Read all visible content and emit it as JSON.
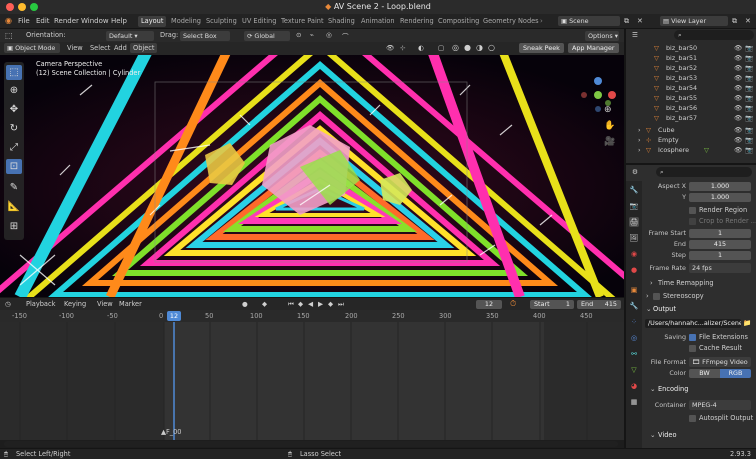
{
  "window": {
    "title": "AV Scene 2 - Loop.blend"
  },
  "menu": {
    "items": [
      "File",
      "Edit",
      "Render",
      "Window",
      "Help"
    ],
    "workspaces": [
      "Layout",
      "Modeling",
      "Sculpting",
      "UV Editing",
      "Texture Paint",
      "Shading",
      "Animation",
      "Rendering",
      "Compositing",
      "Geometry Nodes"
    ],
    "active_workspace": "Layout",
    "scene": "Scene",
    "view_layer": "View Layer"
  },
  "viewport_tool": {
    "orientation_label": "Orientation:",
    "orientation_value": "Default",
    "drag_label": "Drag:",
    "drag_value": "Select Box",
    "transform_value": "Global",
    "options_label": "Options"
  },
  "viewport_header": {
    "mode": "Object Mode",
    "menus": [
      "View",
      "Select",
      "Add",
      "Object"
    ],
    "sneak_peek": "Sneak Peek",
    "app_manager": "App Manager"
  },
  "viewport": {
    "camera_label": "Camera Perspective",
    "collection_label": "(12) Scene Collection | Cylinder"
  },
  "timeline": {
    "menus": [
      "Playback",
      "Keying",
      "View",
      "Marker"
    ],
    "current_frame": "12",
    "start_label": "Start",
    "start_value": "1",
    "end_label": "End",
    "end_value": "415",
    "ruler": [
      "-150",
      "-100",
      "-50",
      "0",
      "50",
      "100",
      "150",
      "200",
      "250",
      "300",
      "350",
      "400",
      "450"
    ],
    "frame_marker": "F_00"
  },
  "outliner": {
    "items": [
      {
        "name": "biz_bar50",
        "type": "mesh"
      },
      {
        "name": "biz_bar51",
        "type": "mesh"
      },
      {
        "name": "biz_bar52",
        "type": "mesh"
      },
      {
        "name": "biz_bar53",
        "type": "mesh"
      },
      {
        "name": "biz_bar54",
        "type": "mesh"
      },
      {
        "name": "biz_bar55",
        "type": "mesh"
      },
      {
        "name": "biz_bar56",
        "type": "mesh"
      },
      {
        "name": "biz_bar57",
        "type": "mesh"
      },
      {
        "name": "Cube",
        "type": "object"
      },
      {
        "name": "Empty",
        "type": "empty"
      },
      {
        "name": "Icosphere",
        "type": "object"
      }
    ]
  },
  "properties": {
    "aspect_x_label": "Aspect X",
    "aspect_x": "1.000",
    "aspect_y_label": "Y",
    "aspect_y": "1.000",
    "render_region": "Render Region",
    "crop_region": "Crop to Render ...",
    "frame_start_label": "Frame Start",
    "frame_start": "1",
    "frame_end_label": "End",
    "frame_end": "415",
    "frame_step_label": "Step",
    "frame_step": "1",
    "frame_rate_label": "Frame Rate",
    "frame_rate": "24 fps",
    "time_remapping": "Time Remapping",
    "stereoscopy": "Stereoscopy",
    "output_panel": "Output",
    "output_path": "/Users/hannahc...alizer/Scene 2/",
    "saving_label": "Saving",
    "file_extensions": "File Extensions",
    "cache_result": "Cache Result",
    "file_format_label": "File Format",
    "file_format": "FFmpeg Video",
    "color_label": "Color",
    "color_bw": "BW",
    "color_rgb": "RGB",
    "encoding_panel": "Encoding",
    "container_label": "Container",
    "container": "MPEG-4",
    "autosplit": "Autosplit Output",
    "video_panel": "Video"
  },
  "status": {
    "left": "Select Left/Right",
    "middle": "Lasso Select",
    "version": "2.93.3"
  },
  "colors": {
    "accent": "#4772b3",
    "playhead": "#4f8ad6",
    "orange": "#e8893a"
  }
}
